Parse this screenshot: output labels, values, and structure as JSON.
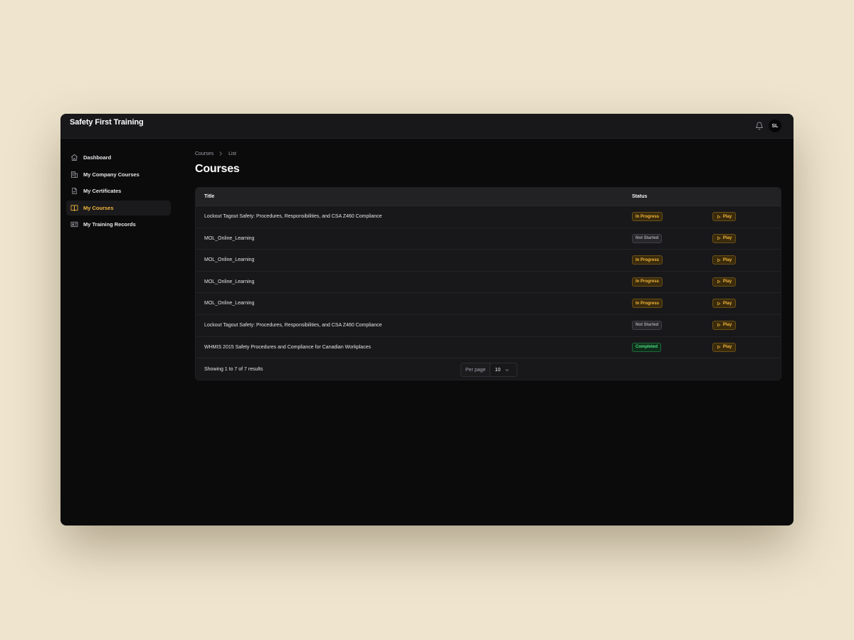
{
  "app": {
    "brand": "Safety First Training",
    "avatar_initials": "SL",
    "accent_color": "#f2b53b"
  },
  "sidebar": {
    "items": [
      {
        "label": "Dashboard",
        "icon": "home-icon",
        "active": false
      },
      {
        "label": "My Company Courses",
        "icon": "building-icon",
        "active": false
      },
      {
        "label": "My Certificates",
        "icon": "certificate-file-icon",
        "active": false
      },
      {
        "label": "My Courses",
        "icon": "book-open-icon",
        "active": true
      },
      {
        "label": "My Training Records",
        "icon": "id-card-icon",
        "active": false
      }
    ]
  },
  "breadcrumb": {
    "items": [
      "Courses",
      "List"
    ]
  },
  "page": {
    "title": "Courses"
  },
  "table": {
    "headers": {
      "title": "Title",
      "status": "Status"
    },
    "rows": [
      {
        "title": "Lockout Tagout Safety: Procedures, Responsibilities, and CSA Z460 Compliance",
        "status": "In Progress",
        "action": "Play"
      },
      {
        "title": "MOL_Online_Learning",
        "status": "Not Started",
        "action": "Play"
      },
      {
        "title": "MOL_Online_Learning",
        "status": "In Progress",
        "action": "Play"
      },
      {
        "title": "MOL_Online_Learning",
        "status": "In Progress",
        "action": "Play"
      },
      {
        "title": "MOL_Online_Learning",
        "status": "In Progress",
        "action": "Play"
      },
      {
        "title": "Lockout Tagout Safety: Procedures, Responsibilities, and CSA Z460 Compliance",
        "status": "Not Started",
        "action": "Play"
      },
      {
        "title": "WHMIS 2015 Safety Procedures and Compliance for Canadian Workplaces",
        "status": "Completed",
        "action": "Play"
      }
    ],
    "status_colors": {
      "In Progress": "#f2b53b",
      "Not Started": "#a1a1aa",
      "Completed": "#4ade80"
    }
  },
  "pagination": {
    "results_text": "Showing 1 to 7 of 7 results",
    "per_page_label": "Per page",
    "per_page_value": "10"
  }
}
